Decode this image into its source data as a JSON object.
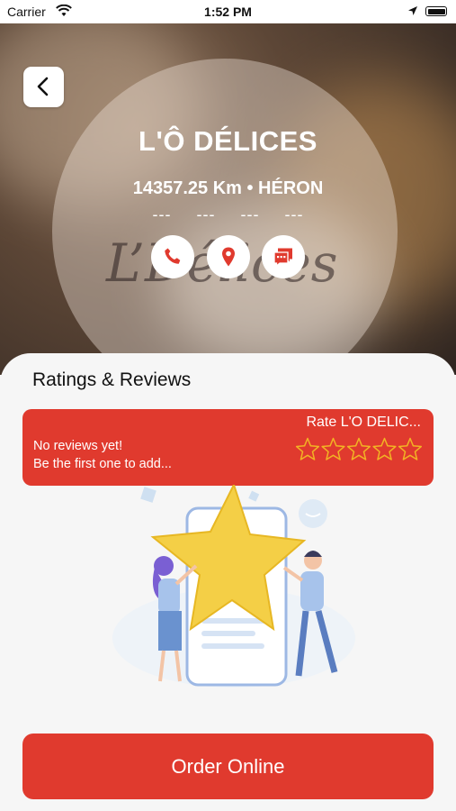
{
  "status_bar": {
    "carrier": "Carrier",
    "time": "1:52 PM"
  },
  "restaurant": {
    "name": "L'Ô DÉLICES",
    "distance": "14357.25 Km • HÉRON",
    "placeholders": "--- --- --- ---"
  },
  "actions": [
    {
      "icon": "phone-icon"
    },
    {
      "icon": "map-pin-icon"
    },
    {
      "icon": "chat-icon"
    }
  ],
  "reviews": {
    "section_title": "Ratings & Reviews",
    "rate_label": "Rate L'O DELIC...",
    "empty_line1": "No reviews yet!",
    "empty_line2": "Be the first one to add...",
    "star_count": 5,
    "rating": 0
  },
  "order": {
    "label": "Order Online"
  },
  "colors": {
    "accent": "#e03a2e",
    "star_outline": "#f2b324"
  }
}
